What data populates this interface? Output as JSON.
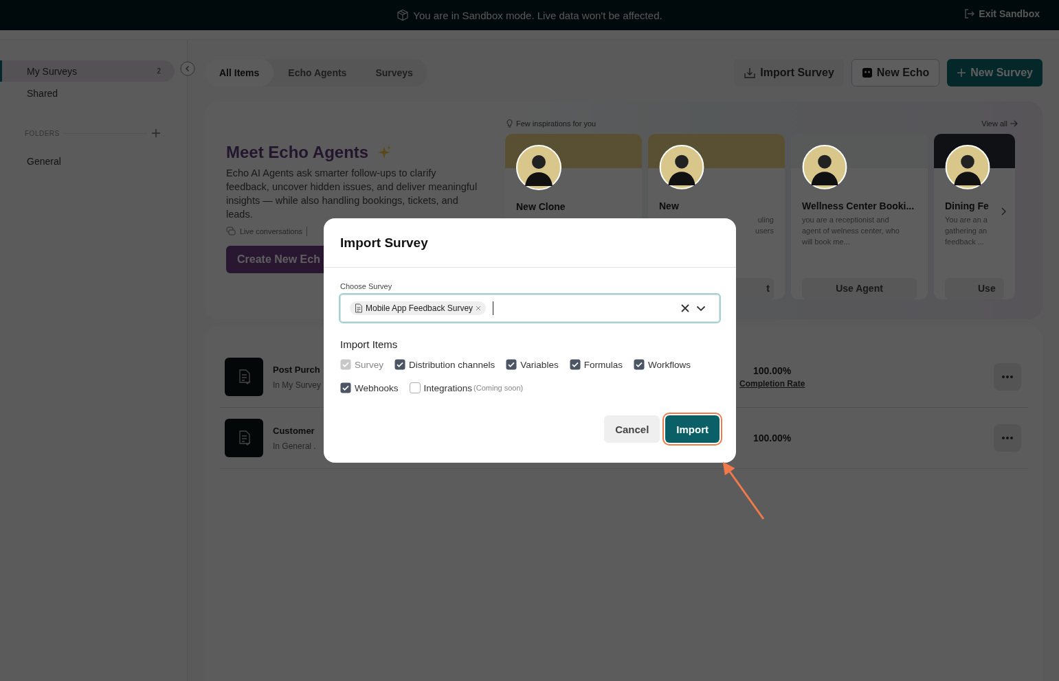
{
  "banner": {
    "message": "You are in Sandbox mode. Live data won't be affected.",
    "exit": "Exit Sandbox"
  },
  "sidebar": {
    "items": [
      {
        "label": "My Surveys",
        "count": "2",
        "selected": true
      },
      {
        "label": "Shared",
        "selected": false
      }
    ],
    "folders_label": "FOLDERS",
    "folders": [
      {
        "label": "General",
        "selected": false
      }
    ]
  },
  "tabs": [
    {
      "label": "All Items",
      "selected": true
    },
    {
      "label": "Echo Agents",
      "selected": false
    },
    {
      "label": "Surveys",
      "selected": false
    }
  ],
  "actions": [
    {
      "kind": "import",
      "label": "Import Survey"
    },
    {
      "kind": "echo",
      "label": "New Echo"
    },
    {
      "kind": "primary",
      "label": "New Survey"
    }
  ],
  "hero": {
    "title": "Meet Echo Agents",
    "description": "Echo AI Agents ask smarter follow-ups to clarify feedback, uncover hidden issues, and deliver meaningful insights — while also handling bookings, tickets, and leads.",
    "feature": "Live conversations",
    "cta": "Create New Ech"
  },
  "inspirations": {
    "label": "Few inspirations for you",
    "view_all": "View all",
    "cards": [
      {
        "title": "New Clone"
      },
      {
        "title": "New",
        "description": [
          "uling",
          "users"
        ],
        "button": "t"
      },
      {
        "title": "Wellness Center Booki...",
        "description": [
          "you are a receptionist and",
          "agent of welness center, who",
          "will book me..."
        ],
        "button": "Use Agent"
      },
      {
        "title": "Dining Fe",
        "description": [
          "You are an a",
          "gathering an",
          "feedback ..."
        ],
        "button": "Use"
      }
    ]
  },
  "surveys": [
    {
      "title": "Post Purch",
      "location": "In My Survey",
      "rate": "100.00%",
      "rate_label": "Completion Rate"
    },
    {
      "title": "Customer",
      "location": "In General .",
      "rate": "100.00%"
    }
  ],
  "modal": {
    "title": "Import Survey",
    "field_label": "Choose Survey",
    "chips": [
      "Mobile App Feedback Survey"
    ],
    "items_label": "Import Items",
    "items": [
      {
        "label": "Survey",
        "checked": true,
        "disabled": true
      },
      {
        "label": "Distribution channels",
        "checked": true,
        "disabled": false
      },
      {
        "label": "Variables",
        "checked": true,
        "disabled": false
      },
      {
        "label": "Formulas",
        "checked": true,
        "disabled": false
      },
      {
        "label": "Workflows",
        "checked": true,
        "disabled": false
      },
      {
        "label": "Webhooks",
        "checked": true,
        "disabled": false
      },
      {
        "label": "Integrations",
        "checked": false,
        "disabled": false,
        "note": "(Coming soon)"
      }
    ],
    "cancel": "Cancel",
    "confirm": "Import",
    "confirm_highlighted": true
  }
}
